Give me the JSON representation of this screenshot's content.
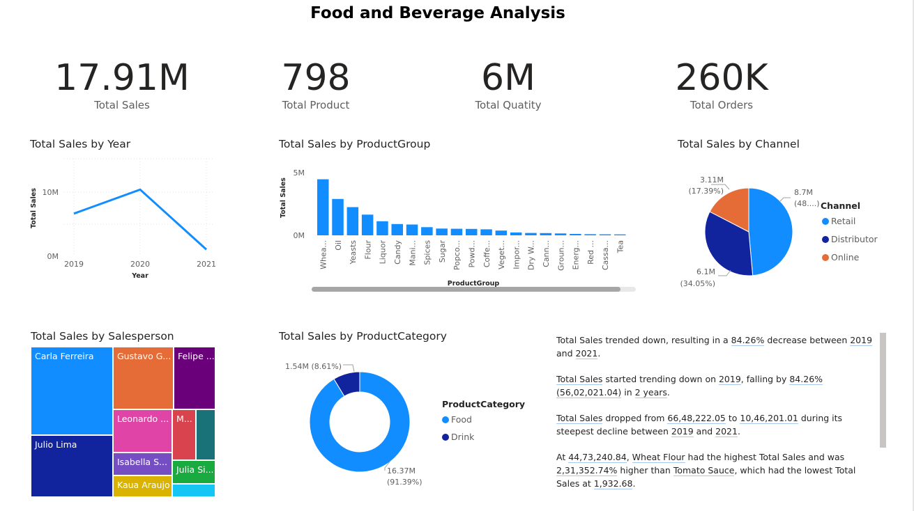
{
  "title": "Food and Beverage Analysis",
  "kpis": [
    {
      "value": "17.91M",
      "label": "Total Sales"
    },
    {
      "value": "798",
      "label": "Total Product"
    },
    {
      "value": "6M",
      "label": "Total Quatity"
    },
    {
      "value": "260K",
      "label": "Total Orders"
    }
  ],
  "chart_data": [
    {
      "type": "line",
      "title": "Total Sales by Year",
      "xlabel": "Year",
      "ylabel": "Total Sales",
      "x": [
        "2019",
        "2020",
        "2021"
      ],
      "values": [
        6648222.05,
        10400000,
        1046201.01
      ],
      "yticks": [
        "0M",
        "10M"
      ],
      "ylim": [
        0,
        14000000
      ],
      "grid": true,
      "color": "#118dff"
    },
    {
      "type": "bar",
      "title": "Total Sales by ProductGroup",
      "xlabel": "ProductGroup",
      "ylabel": "Total Sales",
      "yticks": [
        "0M",
        "5M"
      ],
      "ylim": [
        0,
        5800000
      ],
      "categories": [
        "Whea...",
        "Oil",
        "Yeasts",
        "Flour",
        "Liquor",
        "Candy",
        "Mani...",
        "Spices",
        "Sugar",
        "Popco...",
        "Powd...",
        "Coffe...",
        "Veget...",
        "Impor...",
        "Dry W...",
        "Cann...",
        "Groun...",
        "Energ...",
        "Red ...",
        "Cassa...",
        "Tea"
      ],
      "values": [
        4473240.84,
        2900000,
        2250000,
        1650000,
        1120000,
        900000,
        860000,
        650000,
        540000,
        520000,
        510000,
        480000,
        380000,
        230000,
        190000,
        180000,
        150000,
        110000,
        90000,
        80000,
        70000
      ],
      "color": "#118dff"
    },
    {
      "type": "pie",
      "title": "Total Sales by Channel",
      "legend_title": "Channel",
      "legend_position": "right",
      "slices": [
        {
          "name": "Retail",
          "value": 8.7,
          "percent": 48.56,
          "label": "8.7M",
          "pct_label": "(48....)",
          "color": "#118dff"
        },
        {
          "name": "Distributor",
          "value": 6.1,
          "percent": 34.05,
          "label": "6.1M",
          "pct_label": "(34.05%)",
          "color": "#12239e"
        },
        {
          "name": "Online",
          "value": 3.11,
          "percent": 17.39,
          "label": "3.11M",
          "pct_label": "(17.39%)",
          "color": "#e66c37"
        }
      ]
    },
    {
      "type": "treemap",
      "title": "Total Sales by Salesperson",
      "items": [
        {
          "name": "Carla Ferreira",
          "label": "Carla Ferreira",
          "color": "#118dff"
        },
        {
          "name": "Julio Lima",
          "label": "Julio Lima",
          "color": "#12239e"
        },
        {
          "name": "Gustavo G...",
          "label": "Gustavo G...",
          "color": "#e66c37"
        },
        {
          "name": "Felipe ...",
          "label": "Felipe ...",
          "color": "#6b007b"
        },
        {
          "name": "Leonardo ...",
          "label": "Leonardo ...",
          "color": "#e044a7"
        },
        {
          "name": "M...",
          "label": "M...",
          "color": "#d9434d"
        },
        {
          "name": "",
          "label": "",
          "color": "#197278"
        },
        {
          "name": "Isabella S...",
          "label": "Isabella S...",
          "color": "#744ec2"
        },
        {
          "name": "Julia Si...",
          "label": "Julia Si...",
          "color": "#1aab40"
        },
        {
          "name": "Kaua Araujo",
          "label": "Kaua Araujo",
          "color": "#d9b300"
        },
        {
          "name": "",
          "label": "",
          "color": "#15c6f4"
        }
      ]
    },
    {
      "type": "pie",
      "subtype": "donut",
      "title": "Total Sales by ProductCategory",
      "legend_title": "ProductCategory",
      "legend_position": "right",
      "slices": [
        {
          "name": "Food",
          "value": 16.37,
          "percent": 91.39,
          "label": "16.37M",
          "pct_label": "(91.39%)",
          "color": "#118dff"
        },
        {
          "name": "Drink",
          "value": 1.54,
          "percent": 8.61,
          "label": "1.54M (8.61%)",
          "pct_label": "",
          "color": "#12239e"
        }
      ]
    }
  ],
  "narrative": [
    [
      {
        "t": "Total Sales trended down, resulting in a "
      },
      {
        "t": "84.26%",
        "h": true
      },
      {
        "t": " decrease between "
      },
      {
        "t": "2019",
        "h": true
      },
      {
        "t": " and "
      },
      {
        "t": "2021",
        "h": true
      },
      {
        "t": "."
      }
    ],
    [
      {
        "t": "Total Sales",
        "h": true
      },
      {
        "t": " started trending down on "
      },
      {
        "t": "2019",
        "h": true
      },
      {
        "t": ", falling by "
      },
      {
        "t": "84.26%",
        "h": true
      },
      {
        "t": " "
      },
      {
        "t": "(56,02,021.04)",
        "h": true
      },
      {
        "t": " in "
      },
      {
        "t": "2 years",
        "h": true
      },
      {
        "t": "."
      }
    ],
    [
      {
        "t": "Total Sales",
        "h": true
      },
      {
        "t": " dropped from "
      },
      {
        "t": "66,48,222.05",
        "h": true
      },
      {
        "t": " to "
      },
      {
        "t": "10,46,201.01",
        "h": true
      },
      {
        "t": " during its steepest decline between "
      },
      {
        "t": "2019",
        "h": true
      },
      {
        "t": " and "
      },
      {
        "t": "2021",
        "h": true
      },
      {
        "t": "."
      }
    ],
    [
      {
        "t": "At "
      },
      {
        "t": "44,73,240.84",
        "h": true
      },
      {
        "t": ", "
      },
      {
        "t": "Wheat Flour",
        "h": true
      },
      {
        "t": " had the highest Total Sales and was "
      },
      {
        "t": "2,31,352.74%",
        "h": true
      },
      {
        "t": " higher than "
      },
      {
        "t": "Tomato Sauce",
        "h": true
      },
      {
        "t": ", which had the lowest Total Sales at "
      },
      {
        "t": "1,932.68",
        "h": true
      },
      {
        "t": "."
      }
    ]
  ]
}
